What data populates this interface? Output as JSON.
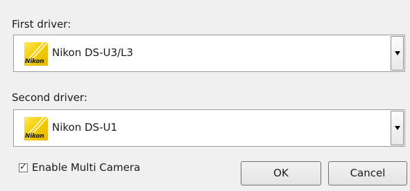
{
  "first_driver": {
    "label": "First driver:",
    "selected": "Nikon DS-U3/L3",
    "logo_text": "Nikon"
  },
  "second_driver": {
    "label": "Second driver:",
    "selected": "Nikon DS-U1",
    "logo_text": "Nikon"
  },
  "multi_camera": {
    "label": "Enable Multi Camera",
    "checked": true,
    "check_glyph": "✓"
  },
  "buttons": {
    "ok": "OK",
    "cancel": "Cancel"
  },
  "colors": {
    "dialog_bg": "#f0f0f0",
    "nikon_yellow": "#f3cd00"
  }
}
